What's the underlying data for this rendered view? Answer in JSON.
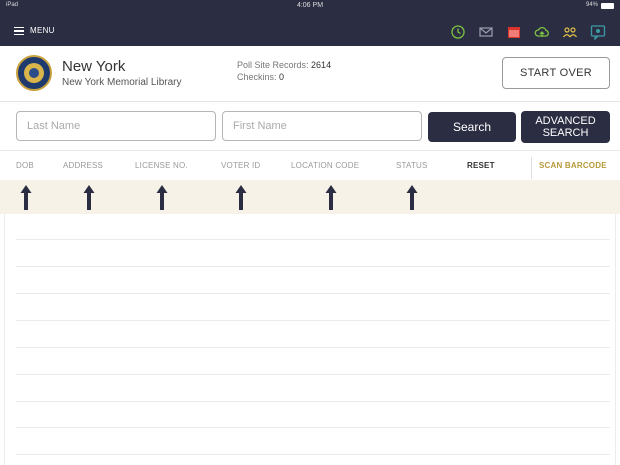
{
  "status_bar": {
    "carrier": "iPad",
    "time": "4:06 PM",
    "battery": "94%"
  },
  "menu": {
    "label": "MENU"
  },
  "toolbar": {
    "icons": [
      "history-icon",
      "mail-icon",
      "calendar-icon",
      "cloud-upload-icon",
      "users-icon",
      "chat-icon"
    ],
    "colors": {
      "bar": "#2b2d42",
      "green": "#7ec242",
      "red": "#d9342b",
      "teal": "#3c9aa5",
      "gold": "#c9a23d"
    }
  },
  "header": {
    "state": "New York",
    "site": "New York Memorial Library",
    "poll_records_label": "Poll Site Records:",
    "poll_records_value": "2614",
    "checkins_label": "Checkins:",
    "checkins_value": "0",
    "start_over": "START OVER"
  },
  "search": {
    "last_name_placeholder": "Last Name",
    "last_name_value": "",
    "first_name_placeholder": "First Name",
    "first_name_value": "",
    "search_label": "Search",
    "advanced_label": "ADVANCED SEARCH"
  },
  "columns": {
    "dob": "DOB",
    "address": "ADDRESS",
    "license": "LICENSE NO.",
    "voter_id": "VOTER ID",
    "location_code": "LOCATION CODE",
    "status": "STATUS",
    "reset": "RESET",
    "scan_barcode": "SCAN BARCODE"
  }
}
